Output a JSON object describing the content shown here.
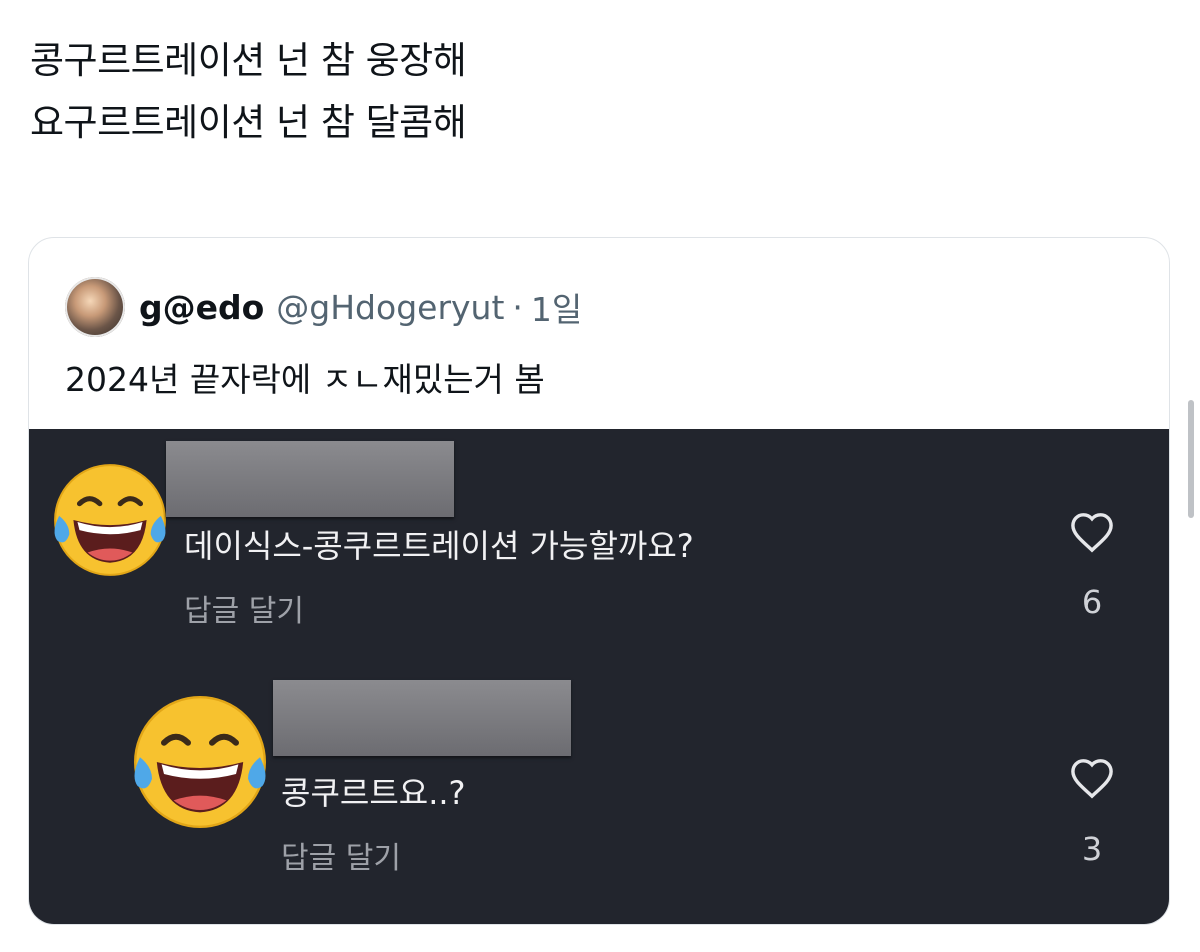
{
  "tweet": {
    "lines": [
      "콩구르트레이션 넌 참 웅장해",
      "요구르트레이션 넌 참 달콤해"
    ]
  },
  "quote": {
    "author_name": "g@edo",
    "author_handle": "@gHdogeryut",
    "separator": "·",
    "time": "1일",
    "text": "2024년 끝자락에 ㅈㄴ재밌는거 봄"
  },
  "comments": [
    {
      "text": "데이식스-콩쿠르트레이션 가능할까요?",
      "reply_label": "답글 달기",
      "likes": "6",
      "icon": "laughing-tears-emoji"
    },
    {
      "text": "콩쿠르트요..?",
      "reply_label": "답글 달기",
      "likes": "3",
      "icon": "laughing-tears-emoji"
    }
  ],
  "colors": {
    "dark_background": "#22252d",
    "handle_gray": "#536471",
    "card_border": "#dfe3e7"
  }
}
